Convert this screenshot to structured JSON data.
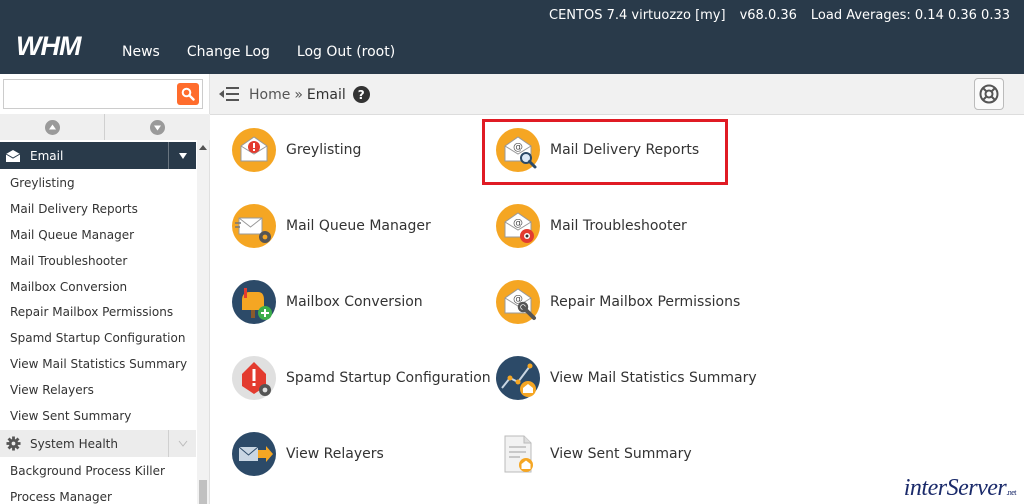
{
  "topbar": {
    "logo_text": "WHM",
    "nav": [
      "News",
      "Change Log",
      "Log Out (root)"
    ],
    "server": "CENTOS 7.4 virtuozzo [my]",
    "version": "v68.0.36",
    "load": "Load Averages: 0.14 0.36 0.33"
  },
  "sidebar": {
    "search": {
      "value": "",
      "placeholder": ""
    },
    "email_category": "Email",
    "email_items": [
      "Greylisting",
      "Mail Delivery Reports",
      "Mail Queue Manager",
      "Mail Troubleshooter",
      "Mailbox Conversion",
      "Repair Mailbox Permissions",
      "Spamd Startup Configuration",
      "View Mail Statistics Summary",
      "View Relayers",
      "View Sent Summary"
    ],
    "health_category": "System Health",
    "health_items": [
      "Background Process Killer",
      "Process Manager"
    ]
  },
  "breadcrumb": {
    "home": "Home",
    "sep": "»",
    "current": "Email"
  },
  "tools": [
    {
      "label": "Greylisting",
      "icon": "greylisting-icon"
    },
    {
      "label": "Mail Delivery Reports",
      "icon": "mail-delivery-reports-icon"
    },
    {
      "label": "Mail Queue Manager",
      "icon": "mail-queue-manager-icon"
    },
    {
      "label": "Mail Troubleshooter",
      "icon": "mail-troubleshooter-icon"
    },
    {
      "label": "Mailbox Conversion",
      "icon": "mailbox-conversion-icon"
    },
    {
      "label": "Repair Mailbox Permissions",
      "icon": "repair-mailbox-permissions-icon"
    },
    {
      "label": "Spamd Startup Configuration",
      "icon": "spamd-startup-configuration-icon"
    },
    {
      "label": "View Mail Statistics Summary",
      "icon": "view-mail-statistics-summary-icon"
    },
    {
      "label": "View Relayers",
      "icon": "view-relayers-icon"
    },
    {
      "label": "View Sent Summary",
      "icon": "view-sent-summary-icon"
    }
  ],
  "watermark": {
    "main": "interServer",
    "suffix": ".net"
  },
  "colors": {
    "header_bg": "#293a4a",
    "accent_orange": "#f5a623",
    "search_btn": "#ff6c2c",
    "highlight": "#e01b24",
    "navy_icon": "#2c4a68"
  }
}
